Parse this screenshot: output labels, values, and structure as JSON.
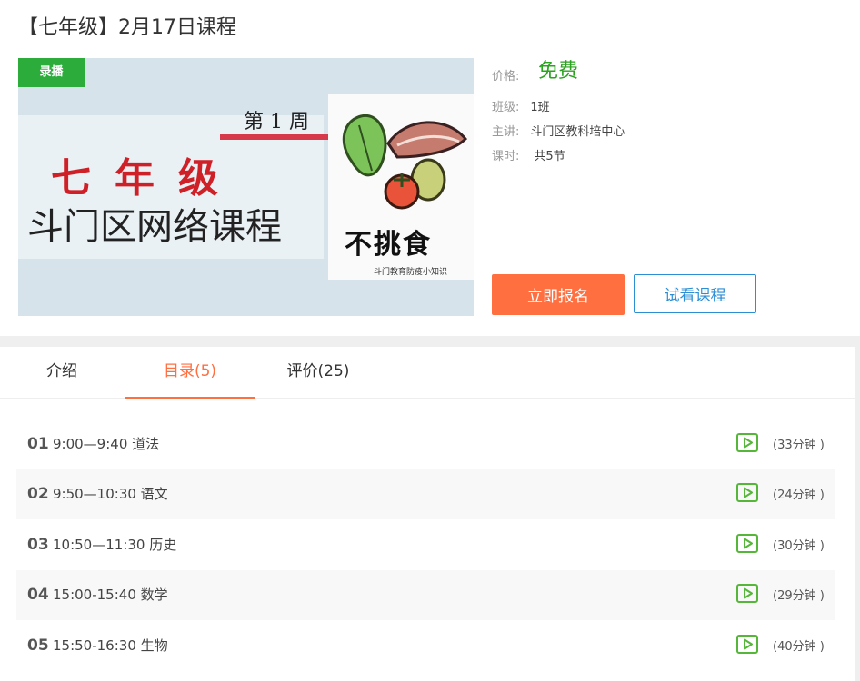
{
  "course": {
    "title": "【七年级】2月17日课程",
    "badge": "录播",
    "cover": {
      "week": "第 1 周",
      "grade": "七年级",
      "school": "斗门区网络课程",
      "topic": "不挑食",
      "caption": "斗门教育防疫小知识"
    }
  },
  "info": {
    "price_label": "价格:",
    "price_value": "免费",
    "class_label": "班级:",
    "class_value": "1班",
    "teacher_label": "主讲:",
    "teacher_value": "斗门区教科培中心",
    "hours_label": "课时:",
    "hours_value": "共5节"
  },
  "actions": {
    "enroll": "立即报名",
    "trial": "试看课程"
  },
  "tabs": [
    {
      "label": "介绍"
    },
    {
      "label": "目录(5)"
    },
    {
      "label": "评价(25)"
    }
  ],
  "lessons": [
    {
      "num": "01",
      "name": "9:00—9:40 道法",
      "duration": "(33分钟 )"
    },
    {
      "num": "02",
      "name": "9:50—10:30 语文",
      "duration": "(24分钟 )"
    },
    {
      "num": "03",
      "name": "10:50—11:30 历史",
      "duration": "(30分钟 )"
    },
    {
      "num": "04",
      "name": "15:00-15:40 数学",
      "duration": "(29分钟 )"
    },
    {
      "num": "05",
      "name": "15:50-16:30 生物",
      "duration": "(40分钟 )"
    }
  ],
  "colors": {
    "accent": "#ff6f40",
    "price": "#2aa31e",
    "badge": "#2bac3b",
    "link": "#2c8fd4",
    "play_icon": "#56b63a"
  }
}
